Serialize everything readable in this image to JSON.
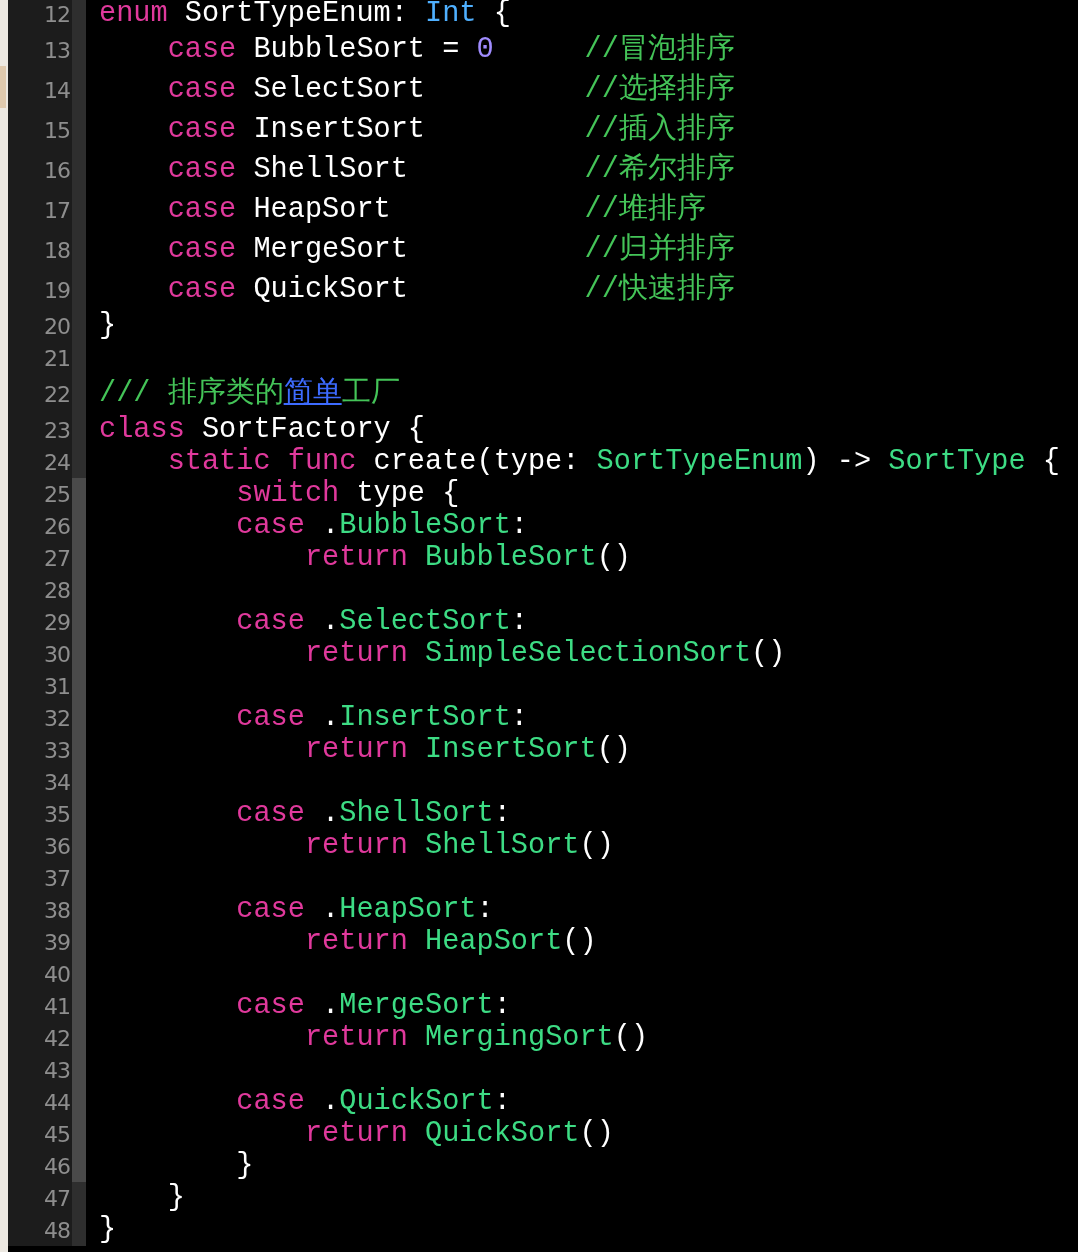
{
  "editor": {
    "lines": [
      {
        "number": "12",
        "tokens": [
          {
            "kind": "keyword",
            "text": "enum"
          },
          {
            "kind": "plain",
            "text": " SortTypeEnum: "
          },
          {
            "kind": "builtin",
            "text": "Int"
          },
          {
            "kind": "plain",
            "text": " {"
          }
        ]
      },
      {
        "number": "13",
        "tokens": [
          {
            "kind": "keyword",
            "text": "    case"
          },
          {
            "kind": "plain",
            "text": " BubbleSort = "
          },
          {
            "kind": "number",
            "text": "0"
          }
        ],
        "comment": "//冒泡排序"
      },
      {
        "number": "14",
        "tokens": [
          {
            "kind": "keyword",
            "text": "    case"
          },
          {
            "kind": "plain",
            "text": " SelectSort"
          }
        ],
        "comment": "//选择排序"
      },
      {
        "number": "15",
        "tokens": [
          {
            "kind": "keyword",
            "text": "    case"
          },
          {
            "kind": "plain",
            "text": " InsertSort"
          }
        ],
        "comment": "//插入排序"
      },
      {
        "number": "16",
        "tokens": [
          {
            "kind": "keyword",
            "text": "    case"
          },
          {
            "kind": "plain",
            "text": " ShellSort"
          }
        ],
        "comment": "//希尔排序"
      },
      {
        "number": "17",
        "tokens": [
          {
            "kind": "keyword",
            "text": "    case"
          },
          {
            "kind": "plain",
            "text": " HeapSort"
          }
        ],
        "comment": "//堆排序"
      },
      {
        "number": "18",
        "tokens": [
          {
            "kind": "keyword",
            "text": "    case"
          },
          {
            "kind": "plain",
            "text": " MergeSort"
          }
        ],
        "comment": "//归并排序"
      },
      {
        "number": "19",
        "tokens": [
          {
            "kind": "keyword",
            "text": "    case"
          },
          {
            "kind": "plain",
            "text": " QuickSort"
          }
        ],
        "comment": "//快速排序"
      },
      {
        "number": "20",
        "tokens": [
          {
            "kind": "plain",
            "text": "}"
          }
        ]
      },
      {
        "number": "21"
      },
      {
        "number": "22",
        "tokens": [
          {
            "kind": "comment",
            "text": "/// 排序类的"
          },
          {
            "kind": "link",
            "text": "简单"
          },
          {
            "kind": "comment",
            "text": "工厂"
          }
        ]
      },
      {
        "number": "23",
        "tokens": [
          {
            "kind": "keyword",
            "text": "class"
          },
          {
            "kind": "plain",
            "text": " SortFactory {"
          }
        ]
      },
      {
        "number": "24",
        "tokens": [
          {
            "kind": "keyword",
            "text": "    static func"
          },
          {
            "kind": "plain",
            "text": " create(type: "
          },
          {
            "kind": "type",
            "text": "SortTypeEnum"
          },
          {
            "kind": "plain",
            "text": ") -> "
          },
          {
            "kind": "type",
            "text": "SortType"
          },
          {
            "kind": "plain",
            "text": " {"
          }
        ]
      },
      {
        "number": "25",
        "tokens": [
          {
            "kind": "keyword",
            "text": "        switch"
          },
          {
            "kind": "plain",
            "text": " type {"
          }
        ]
      },
      {
        "number": "26",
        "tokens": [
          {
            "kind": "keyword",
            "text": "        case"
          },
          {
            "kind": "plain",
            "text": " ."
          },
          {
            "kind": "type",
            "text": "BubbleSort"
          },
          {
            "kind": "plain",
            "text": ":"
          }
        ]
      },
      {
        "number": "27",
        "tokens": [
          {
            "kind": "keyword",
            "text": "            return "
          },
          {
            "kind": "type",
            "text": "BubbleSort"
          },
          {
            "kind": "plain",
            "text": "()"
          }
        ]
      },
      {
        "number": "28"
      },
      {
        "number": "29",
        "tokens": [
          {
            "kind": "keyword",
            "text": "        case"
          },
          {
            "kind": "plain",
            "text": " ."
          },
          {
            "kind": "type",
            "text": "SelectSort"
          },
          {
            "kind": "plain",
            "text": ":"
          }
        ]
      },
      {
        "number": "30",
        "tokens": [
          {
            "kind": "keyword",
            "text": "            return "
          },
          {
            "kind": "type",
            "text": "SimpleSelectionSort"
          },
          {
            "kind": "plain",
            "text": "()"
          }
        ]
      },
      {
        "number": "31"
      },
      {
        "number": "32",
        "tokens": [
          {
            "kind": "keyword",
            "text": "        case"
          },
          {
            "kind": "plain",
            "text": " ."
          },
          {
            "kind": "type",
            "text": "InsertSort"
          },
          {
            "kind": "plain",
            "text": ":"
          }
        ]
      },
      {
        "number": "33",
        "tokens": [
          {
            "kind": "keyword",
            "text": "            return "
          },
          {
            "kind": "type",
            "text": "InsertSort"
          },
          {
            "kind": "plain",
            "text": "()"
          }
        ]
      },
      {
        "number": "34"
      },
      {
        "number": "35",
        "tokens": [
          {
            "kind": "keyword",
            "text": "        case"
          },
          {
            "kind": "plain",
            "text": " ."
          },
          {
            "kind": "type",
            "text": "ShellSort"
          },
          {
            "kind": "plain",
            "text": ":"
          }
        ]
      },
      {
        "number": "36",
        "tokens": [
          {
            "kind": "keyword",
            "text": "            return "
          },
          {
            "kind": "type",
            "text": "ShellSort"
          },
          {
            "kind": "plain",
            "text": "()"
          }
        ]
      },
      {
        "number": "37"
      },
      {
        "number": "38",
        "tokens": [
          {
            "kind": "keyword",
            "text": "        case"
          },
          {
            "kind": "plain",
            "text": " ."
          },
          {
            "kind": "type",
            "text": "HeapSort"
          },
          {
            "kind": "plain",
            "text": ":"
          }
        ]
      },
      {
        "number": "39",
        "tokens": [
          {
            "kind": "keyword",
            "text": "            return "
          },
          {
            "kind": "type",
            "text": "HeapSort"
          },
          {
            "kind": "plain",
            "text": "()"
          }
        ]
      },
      {
        "number": "40"
      },
      {
        "number": "41",
        "tokens": [
          {
            "kind": "keyword",
            "text": "        case"
          },
          {
            "kind": "plain",
            "text": " ."
          },
          {
            "kind": "type",
            "text": "MergeSort"
          },
          {
            "kind": "plain",
            "text": ":"
          }
        ]
      },
      {
        "number": "42",
        "tokens": [
          {
            "kind": "keyword",
            "text": "            return "
          },
          {
            "kind": "type",
            "text": "MergingSort"
          },
          {
            "kind": "plain",
            "text": "()"
          }
        ]
      },
      {
        "number": "43"
      },
      {
        "number": "44",
        "tokens": [
          {
            "kind": "keyword",
            "text": "        case"
          },
          {
            "kind": "plain",
            "text": " ."
          },
          {
            "kind": "type",
            "text": "QuickSort"
          },
          {
            "kind": "plain",
            "text": ":"
          }
        ]
      },
      {
        "number": "45",
        "tokens": [
          {
            "kind": "keyword",
            "text": "            return "
          },
          {
            "kind": "type",
            "text": "QuickSort"
          },
          {
            "kind": "plain",
            "text": "()"
          }
        ]
      },
      {
        "number": "46",
        "tokens": [
          {
            "kind": "plain",
            "text": "        }"
          }
        ]
      },
      {
        "number": "47",
        "tokens": [
          {
            "kind": "plain",
            "text": "    }"
          }
        ]
      },
      {
        "number": "48",
        "tokens": [
          {
            "kind": "plain",
            "text": "}"
          }
        ]
      }
    ]
  }
}
